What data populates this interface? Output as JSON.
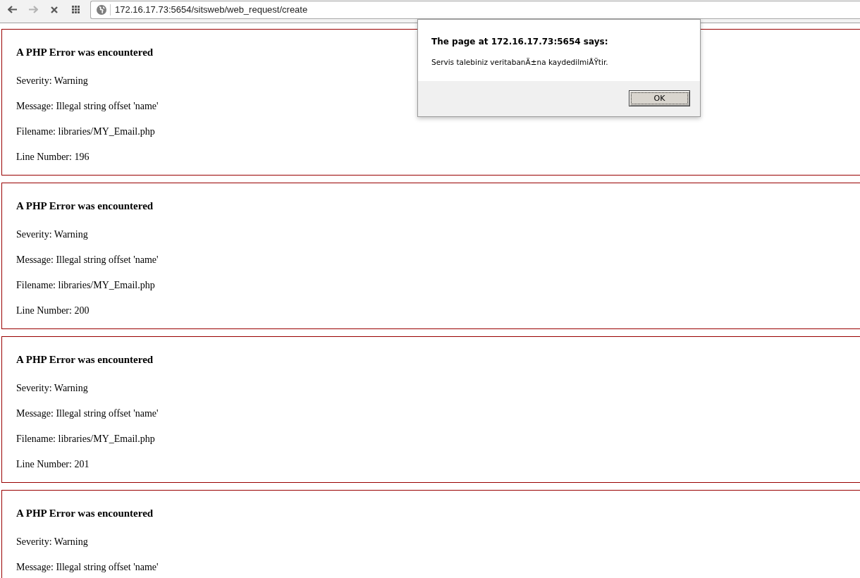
{
  "browser": {
    "nav_buttons": [
      {
        "kind": "back",
        "disabled": false
      },
      {
        "kind": "forward",
        "disabled": true
      },
      {
        "kind": "stop",
        "disabled": false
      },
      {
        "kind": "apps",
        "disabled": false
      }
    ],
    "url": "172.16.17.73:5654/sitsweb/web_request/create"
  },
  "errors": [
    {
      "heading": "A PHP Error was encountered",
      "lines": [
        "Severity: Warning",
        "Message: Illegal string offset 'name'",
        "Filename: libraries/MY_Email.php",
        "Line Number: 196"
      ]
    },
    {
      "heading": "A PHP Error was encountered",
      "lines": [
        "Severity: Warning",
        "Message: Illegal string offset 'name'",
        "Filename: libraries/MY_Email.php",
        "Line Number: 200"
      ]
    },
    {
      "heading": "A PHP Error was encountered",
      "lines": [
        "Severity: Warning",
        "Message: Illegal string offset 'name'",
        "Filename: libraries/MY_Email.php",
        "Line Number: 201"
      ]
    },
    {
      "heading": "A PHP Error was encountered",
      "lines": [
        "Severity: Warning",
        "Message: Illegal string offset 'name'"
      ]
    }
  ],
  "alert": {
    "title": "The page at 172.16.17.73:5654 says:",
    "message": "Servis talebiniz veritabanÄ±na kaydedilmiÅŸtir.",
    "buttons": [
      "OK"
    ]
  }
}
